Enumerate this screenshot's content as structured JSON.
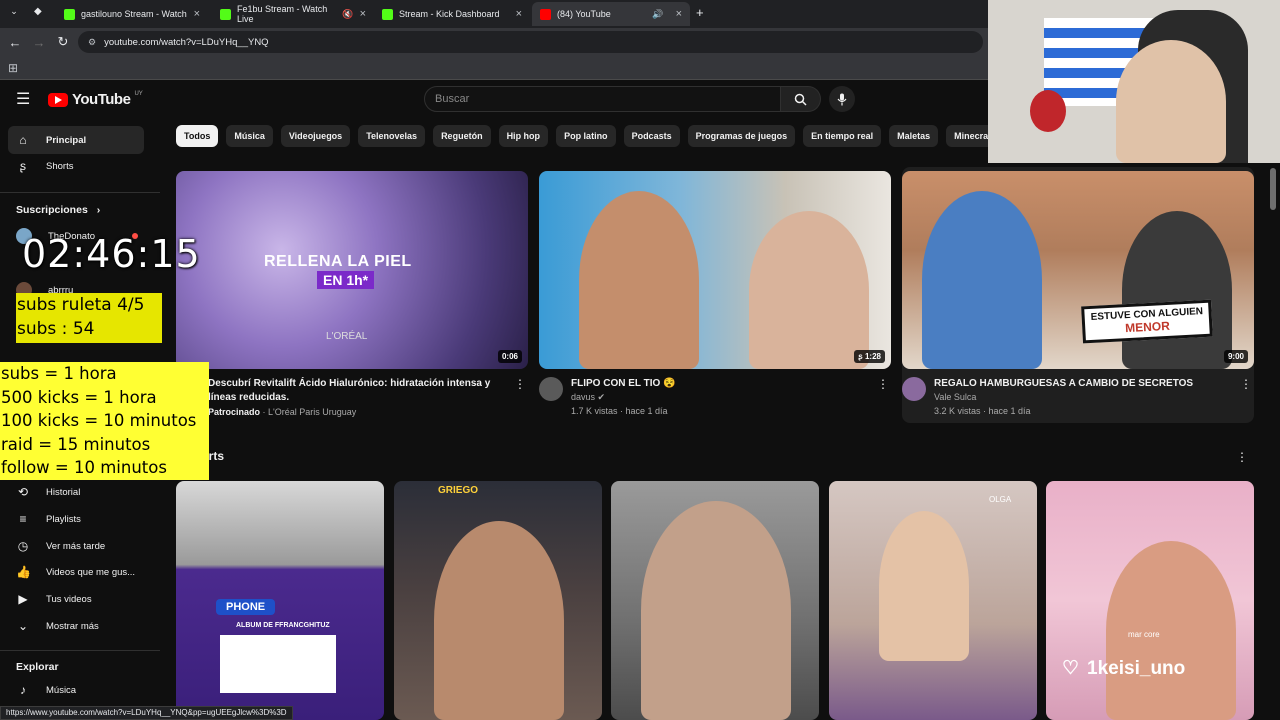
{
  "browser": {
    "tabs": [
      {
        "label": "gastilouno Stream - Watch",
        "favicon_color": "#53fc18",
        "active": false
      },
      {
        "label": "Fe1bu Stream - Watch Live",
        "favicon_color": "#53fc18",
        "active": false
      },
      {
        "label": "Stream - Kick Dashboard",
        "favicon_color": "#53fc18",
        "active": false
      },
      {
        "label": "(84) YouTube",
        "favicon_color": "#ff0000",
        "active": true
      }
    ],
    "url": "youtube.com/watch?v=LDuYHq__YNQ",
    "status_url": "https://www.youtube.com/watch?v=LDuYHq__YNQ&pp=ugUEEgJlcw%3D%3D"
  },
  "header": {
    "logo_text": "YouTube",
    "country": "UY",
    "search_placeholder": "Buscar",
    "icons": [
      "hamburger-icon",
      "search-icon",
      "mic-icon"
    ]
  },
  "sidebar": {
    "main_items": [
      {
        "label": "Principal",
        "icon": "home-icon",
        "active": true
      },
      {
        "label": "Shorts",
        "icon": "shorts-icon",
        "active": false
      }
    ],
    "subscriptions_heading": "Suscripciones",
    "subscriptions": [
      {
        "label": "TheDonato",
        "live": true,
        "color": "#7aa6c8"
      },
      {
        "label": "abrrru",
        "live": false,
        "color": "#6b4a3a"
      }
    ],
    "you_items": [
      {
        "label": "Historial",
        "icon": "history-icon"
      },
      {
        "label": "Playlists",
        "icon": "playlists-icon"
      },
      {
        "label": "Ver más tarde",
        "icon": "clock-icon"
      },
      {
        "label": "Videos que me gus...",
        "icon": "thumbs-up-icon"
      },
      {
        "label": "Tus videos",
        "icon": "play-square-icon"
      },
      {
        "label": "Mostrar más",
        "icon": "chevron-down-icon"
      }
    ],
    "explore_heading": "Explorar",
    "explore_items": [
      {
        "label": "Música",
        "icon": "music-icon"
      }
    ]
  },
  "chips": [
    "Todos",
    "Música",
    "Videojuegos",
    "Telenovelas",
    "Reguetón",
    "Hip hop",
    "Pop latino",
    "Podcasts",
    "Programas de juegos",
    "En tiempo real",
    "Maletas",
    "Minecraft"
  ],
  "videos": [
    {
      "title": "Descubrí Revitalift Ácido Hialurónico: hidratación intensa y líneas reducidas.",
      "channel": "L'Oréal Paris Uruguay",
      "sponsored_label": "Patrocinado",
      "stats": "",
      "duration": "0:06",
      "overlay": "RELLENA LA PIEL",
      "overlay2": "EN 1h*",
      "brand": "L'ORÉAL"
    },
    {
      "title": "FLIPO CON EL TIO 😵",
      "channel": "davus",
      "verified": true,
      "stats": "1.7 K vistas · hace 1 día",
      "duration": "1:28"
    },
    {
      "title": "REGALO HAMBURGUESAS A CAMBIO DE SECRETOS",
      "channel": "Vale Sulca",
      "stats": "3.2 K vistas · hace 1 día",
      "duration": "9:00",
      "overlay": "ESTUVE CON ALGUIEN",
      "overlay2": "MENOR"
    }
  ],
  "shorts": {
    "heading": "Shorts",
    "items": [
      {
        "caption": "ALBUM DE FFRANCGHITUZ",
        "badge": "PHONE"
      },
      {
        "caption": "GRIEGO"
      },
      {
        "caption": ""
      },
      {
        "caption": "OLGA"
      },
      {
        "caption": "mar core",
        "overlay": "1keisi_uno"
      }
    ]
  },
  "overlay": {
    "timer": "02:46:15",
    "subs_lines": [
      "subs ruleta 4/5",
      "subs : 54"
    ],
    "rules_lines": [
      "subs = 1 hora",
      "500 kicks = 1 hora",
      "100 kicks = 10 minutos",
      "raid = 15 minutos",
      "follow = 10 minutos"
    ]
  }
}
